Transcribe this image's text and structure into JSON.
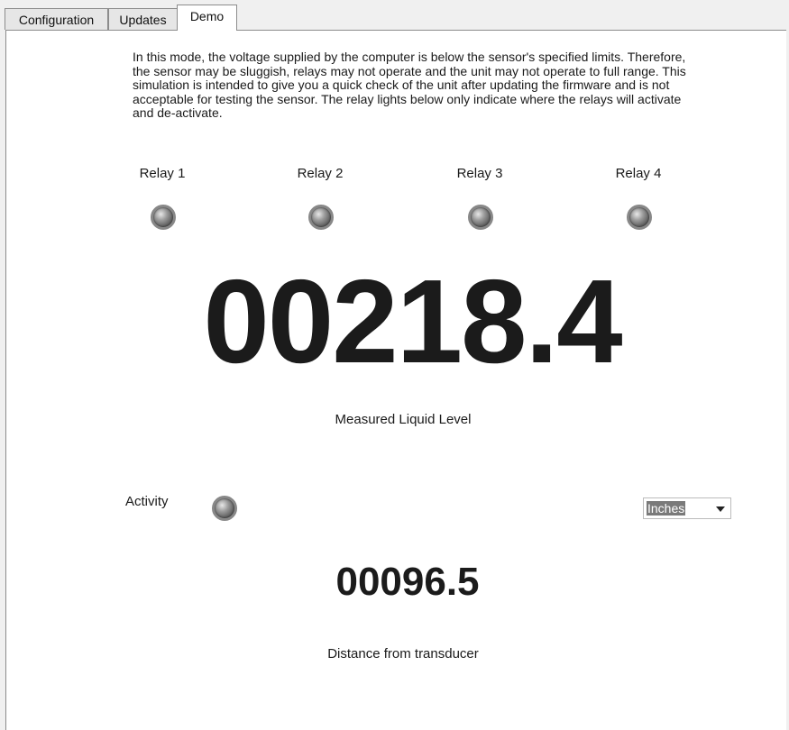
{
  "tabs": [
    {
      "label": "Configuration"
    },
    {
      "label": "Updates"
    },
    {
      "label": "Demo",
      "active": true
    }
  ],
  "demo": {
    "notice": "In this mode, the voltage supplied by the computer is below the sensor's specified limits. Therefore, the sensor may be sluggish, relays may not operate and the unit may not operate to full range. This simulation is intended to give you a quick check of the unit after updating the firmware and is not acceptable for testing the sensor. The relay lights below only indicate where the relays will activate and de-activate.",
    "relays": [
      {
        "label": "Relay 1",
        "state": "off"
      },
      {
        "label": "Relay 2",
        "state": "off"
      },
      {
        "label": "Relay 3",
        "state": "off"
      },
      {
        "label": "Relay 4",
        "state": "off"
      }
    ],
    "level_value": "00218.4",
    "level_caption": "Measured Liquid Level",
    "activity_label": "Activity",
    "activity_state": "off",
    "units": {
      "selected": "Inches"
    },
    "distance_value": "00096.5",
    "distance_caption": "Distance from transducer"
  },
  "colors": {
    "led_off": "#6e6e6e",
    "panel_bg": "#ffffff",
    "window_bg": "#f0f0f0",
    "readout_text": "#1b1b1b"
  }
}
